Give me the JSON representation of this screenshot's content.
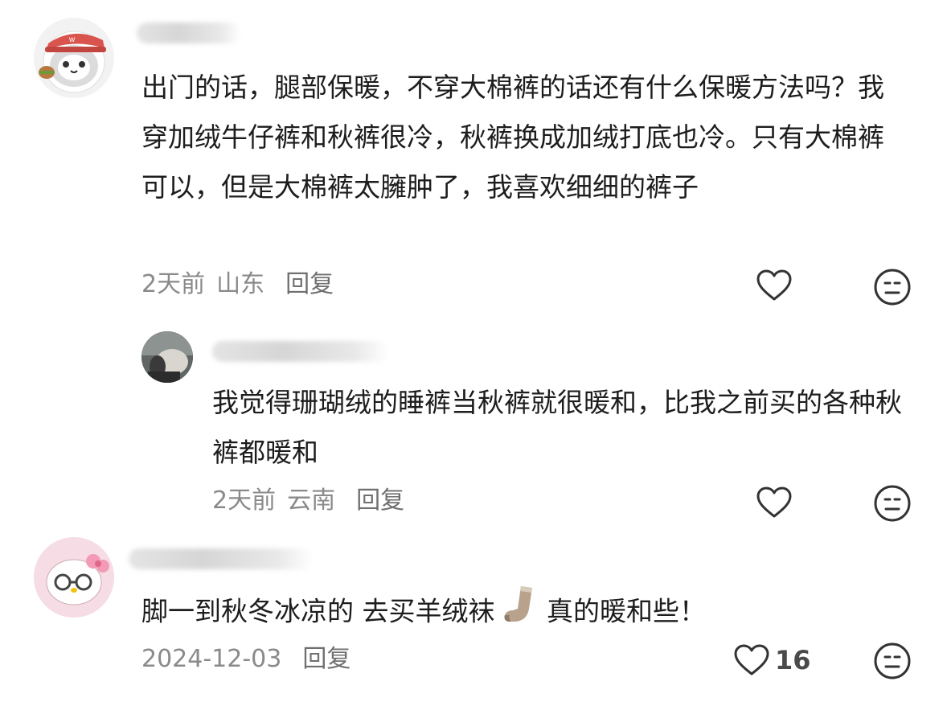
{
  "comments": [
    {
      "text": "出门的话，腿部保暖，不穿大棉裤的话还有什么保暖方法吗？我穿加绒牛仔裤和秋裤很冷，秋裤换成加绒打底也冷。只有大棉裤可以，但是大棉裤太臃肿了，我喜欢细细的裤子",
      "time": "2天前",
      "location": "山东",
      "reply_label": "回复",
      "like_icon": "heart-outline-icon",
      "dislike_icon": "meh-face-icon"
    },
    {
      "text": "我觉得珊瑚绒的睡裤当秋裤就很暖和，比我之前买的各种秋裤都暖和",
      "time": "2天前",
      "location": "云南",
      "reply_label": "回复",
      "like_icon": "heart-outline-icon",
      "dislike_icon": "meh-face-icon"
    },
    {
      "text_before": "脚一到秋冬冰凉的 去买羊绒袜",
      "text_after": " 真的暖和些！",
      "emoji": "sock-emoji",
      "time": "2024-12-03",
      "reply_label": "回复",
      "like_count": "16",
      "like_icon": "heart-outline-icon",
      "dislike_icon": "meh-face-icon"
    }
  ]
}
